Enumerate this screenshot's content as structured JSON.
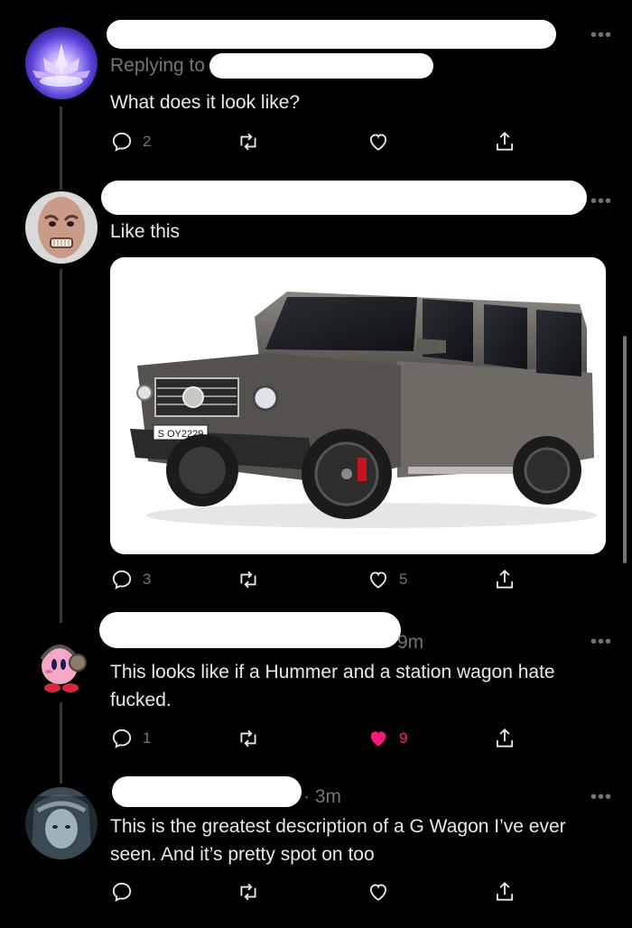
{
  "tweets": [
    {
      "replying_to": "Replying to",
      "text": "What does it look like?",
      "actions": {
        "replies": "2",
        "retweets": "",
        "likes": ""
      }
    },
    {
      "text": "Like this",
      "media": {
        "plate": "S OY2229"
      },
      "actions": {
        "replies": "3",
        "retweets": "",
        "likes": "5"
      }
    },
    {
      "time": "9m",
      "text": "This looks like if a Hummer and a station wagon hate fucked.",
      "actions": {
        "replies": "1",
        "retweets": "",
        "likes": "9"
      }
    },
    {
      "time": "· 3m",
      "text": "This is the greatest description of a G Wagon I’ve ever seen. And it’s pretty spot on too",
      "actions": {
        "replies": "",
        "retweets": "",
        "likes": ""
      }
    }
  ],
  "more_label": "•••",
  "colors": {
    "background": "#000000",
    "text": "#e7e9ea",
    "muted": "#71767b",
    "like_active": "#f91880"
  },
  "icons": [
    "reply-icon",
    "retweet-icon",
    "like-icon",
    "share-icon"
  ]
}
